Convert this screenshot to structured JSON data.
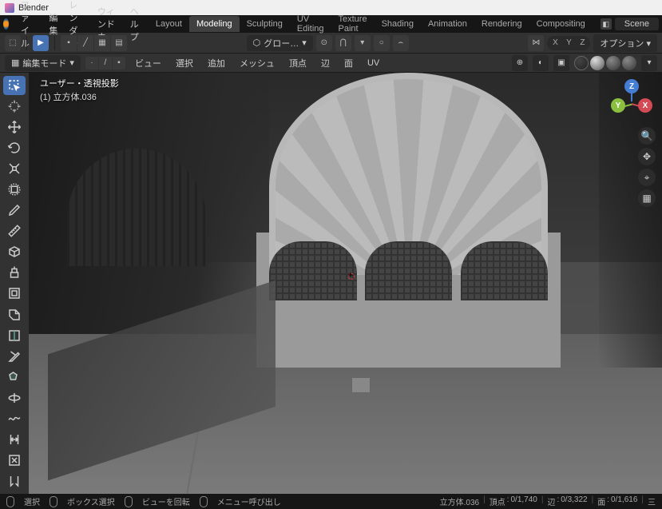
{
  "titlebar": {
    "app_name": "Blender"
  },
  "menubar": {
    "file": "ファイル",
    "edit": "編集",
    "render": "レンダー",
    "window": "ウィンドウ",
    "help": "ヘルプ",
    "workspaces": {
      "layout": "Layout",
      "modeling": "Modeling",
      "sculpting": "Sculpting",
      "uv": "UV Editing",
      "texture": "Texture Paint",
      "shading": "Shading",
      "animation": "Animation",
      "rendering": "Rendering",
      "compositing": "Compositing"
    },
    "scene_label": "Scene"
  },
  "toolbar": {
    "orientation": "グロー…",
    "axes": {
      "x": "X",
      "y": "Y",
      "z": "Z"
    },
    "options": "オプション"
  },
  "header": {
    "mode": "編集モード",
    "menus": {
      "view": "ビュー",
      "select": "選択",
      "add": "追加",
      "mesh": "メッシュ",
      "vertex": "頂点",
      "edge": "辺",
      "face": "面",
      "uv": "UV"
    }
  },
  "viewport": {
    "label_line1": "ユーザー・透視投影",
    "label_line2": "(1) 立方体.036",
    "axes": {
      "x": "X",
      "y": "Y",
      "z": "Z"
    }
  },
  "statusbar": {
    "select": "選択",
    "box_select": "ボックス選択",
    "rotate_view": "ビューを回転",
    "call_menu": "メニュー呼び出し",
    "object_name": "立方体.036",
    "verts_label": "頂点",
    "verts": "0/1,740",
    "edges_label": "辺",
    "edges": "0/3,322",
    "faces_label": "面",
    "faces": "0/1,616",
    "tris_label": "三"
  }
}
